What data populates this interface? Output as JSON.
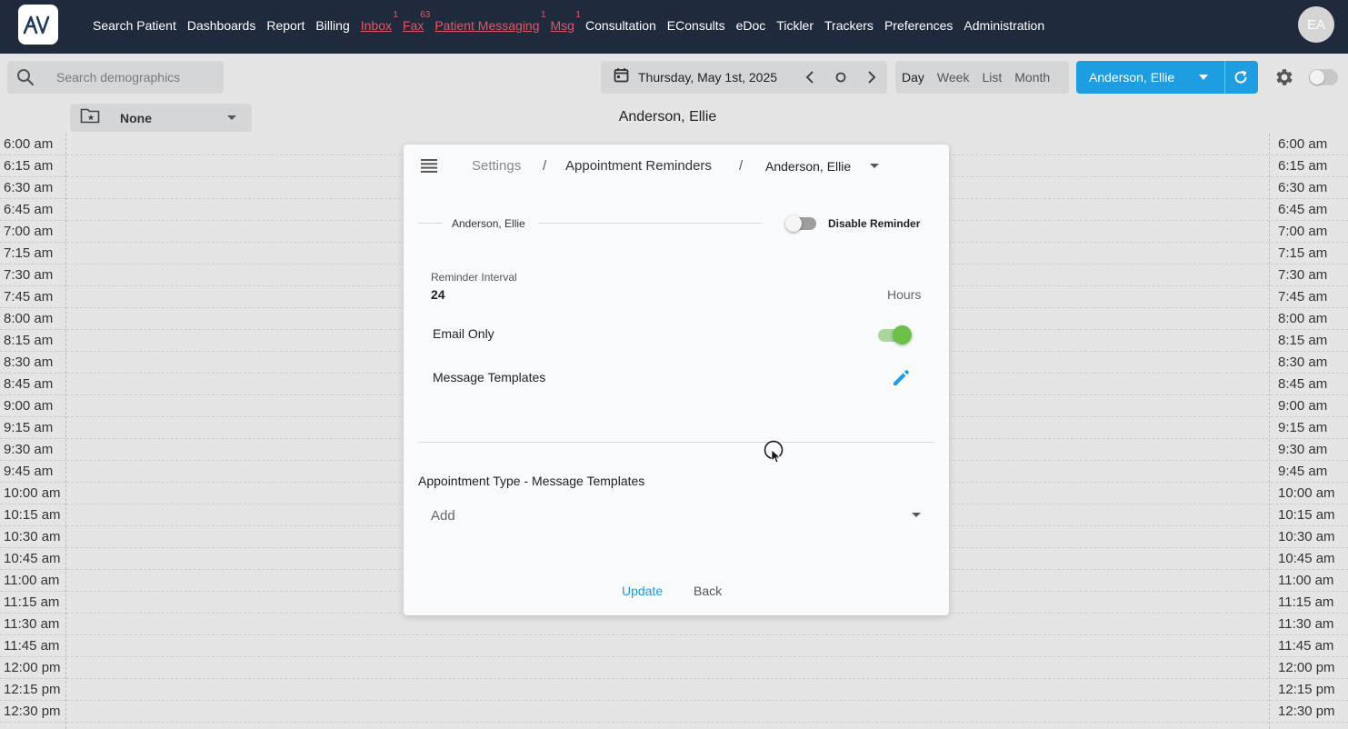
{
  "nav": {
    "logo_text": "AV",
    "items": [
      {
        "label": "Search Patient",
        "badge": "",
        "alert": false
      },
      {
        "label": "Dashboards",
        "badge": "",
        "alert": false
      },
      {
        "label": "Report",
        "badge": "",
        "alert": false
      },
      {
        "label": "Billing",
        "badge": "",
        "alert": false
      },
      {
        "label": "Inbox",
        "badge": "1",
        "alert": true
      },
      {
        "label": "Fax",
        "badge": "63",
        "alert": true
      },
      {
        "label": "Patient Messaging",
        "badge": "1",
        "alert": true
      },
      {
        "label": "Msg",
        "badge": "1",
        "alert": true
      },
      {
        "label": "Consultation",
        "badge": "",
        "alert": false
      },
      {
        "label": "EConsults",
        "badge": "",
        "alert": false
      },
      {
        "label": "eDoc",
        "badge": "",
        "alert": false
      },
      {
        "label": "Tickler",
        "badge": "",
        "alert": false
      },
      {
        "label": "Trackers",
        "badge": "",
        "alert": false
      },
      {
        "label": "Preferences",
        "badge": "",
        "alert": false
      },
      {
        "label": "Administration",
        "badge": "",
        "alert": false
      }
    ],
    "avatar_initials": "EA"
  },
  "toolbar": {
    "search_placeholder": "Search demographics",
    "date_label": "Thursday, May 1st, 2025",
    "views": [
      "Day",
      "Week",
      "List",
      "Month"
    ],
    "active_view": "Day",
    "provider": "Anderson, Ellie"
  },
  "calendar": {
    "folder_label": "None",
    "column_header": "Anderson, Ellie",
    "time_slots": [
      "6:00 am",
      "6:15 am",
      "6:30 am",
      "6:45 am",
      "7:00 am",
      "7:15 am",
      "7:30 am",
      "7:45 am",
      "8:00 am",
      "8:15 am",
      "8:30 am",
      "8:45 am",
      "9:00 am",
      "9:15 am",
      "9:30 am",
      "9:45 am",
      "10:00 am",
      "10:15 am",
      "10:30 am",
      "10:45 am",
      "11:00 am",
      "11:15 am",
      "11:30 am",
      "11:45 am",
      "12:00 pm",
      "12:15 pm",
      "12:30 pm"
    ]
  },
  "dialog": {
    "breadcrumb": {
      "settings": "Settings",
      "separator": "/",
      "section": "Appointment Reminders",
      "provider": "Anderson, Ellie"
    },
    "section_name": "Anderson, Ellie",
    "disable_label": "Disable Reminder",
    "disable_on": false,
    "interval_label": "Reminder Interval",
    "interval_value": "24",
    "interval_unit": "Hours",
    "email_only_label": "Email Only",
    "email_only_on": true,
    "message_templates_label": "Message Templates",
    "appointment_type_label": "Appointment Type - Message Templates",
    "appointment_type_placeholder": "Add",
    "update_label": "Update",
    "back_label": "Back"
  },
  "colors": {
    "nav_bg": "#1f2b3d",
    "accent_blue": "#1e9de0",
    "alert_red": "#e0576a",
    "toggle_green": "#6cc04a"
  }
}
